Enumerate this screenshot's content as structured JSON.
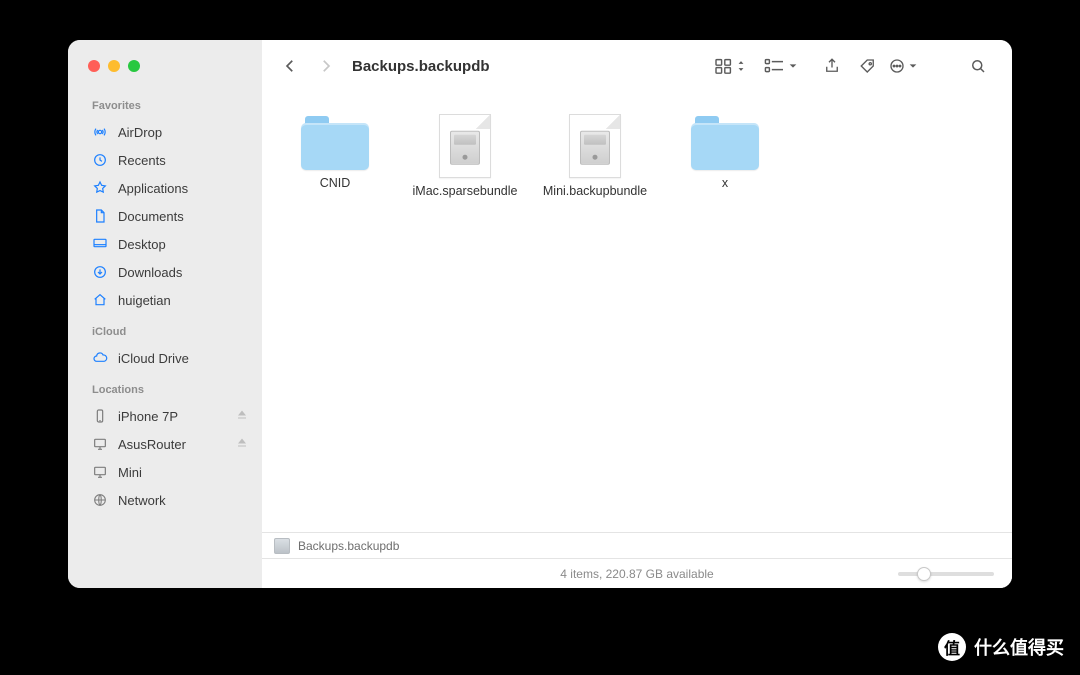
{
  "window": {
    "title": "Backups.backupdb"
  },
  "sidebar": {
    "sections": [
      {
        "title": "Favorites",
        "items": [
          {
            "icon": "airdrop-icon",
            "label": "AirDrop"
          },
          {
            "icon": "clock-icon",
            "label": "Recents"
          },
          {
            "icon": "applications-icon",
            "label": "Applications"
          },
          {
            "icon": "document-icon",
            "label": "Documents"
          },
          {
            "icon": "desktop-icon",
            "label": "Desktop"
          },
          {
            "icon": "downloads-icon",
            "label": "Downloads"
          },
          {
            "icon": "house-icon",
            "label": "huigetian"
          }
        ]
      },
      {
        "title": "iCloud",
        "items": [
          {
            "icon": "cloud-icon",
            "label": "iCloud Drive"
          }
        ]
      },
      {
        "title": "Locations",
        "items": [
          {
            "icon": "iphone-icon",
            "label": "iPhone 7P",
            "eject": true
          },
          {
            "icon": "monitor-icon",
            "label": "AsusRouter",
            "eject": true
          },
          {
            "icon": "monitor-icon",
            "label": "Mini"
          },
          {
            "icon": "globe-icon",
            "label": "Network"
          }
        ]
      }
    ]
  },
  "items": [
    {
      "type": "folder",
      "name": "CNID"
    },
    {
      "type": "bundle",
      "name": "iMac.sparsebundle"
    },
    {
      "type": "bundle",
      "name": "Mini.backupbundle"
    },
    {
      "type": "folder",
      "name": "x"
    }
  ],
  "pathbar": {
    "label": "Backups.backupdb"
  },
  "status": {
    "text": "4 items, 220.87 GB available"
  },
  "watermark": {
    "text": "什么值得买",
    "badge": "值"
  }
}
